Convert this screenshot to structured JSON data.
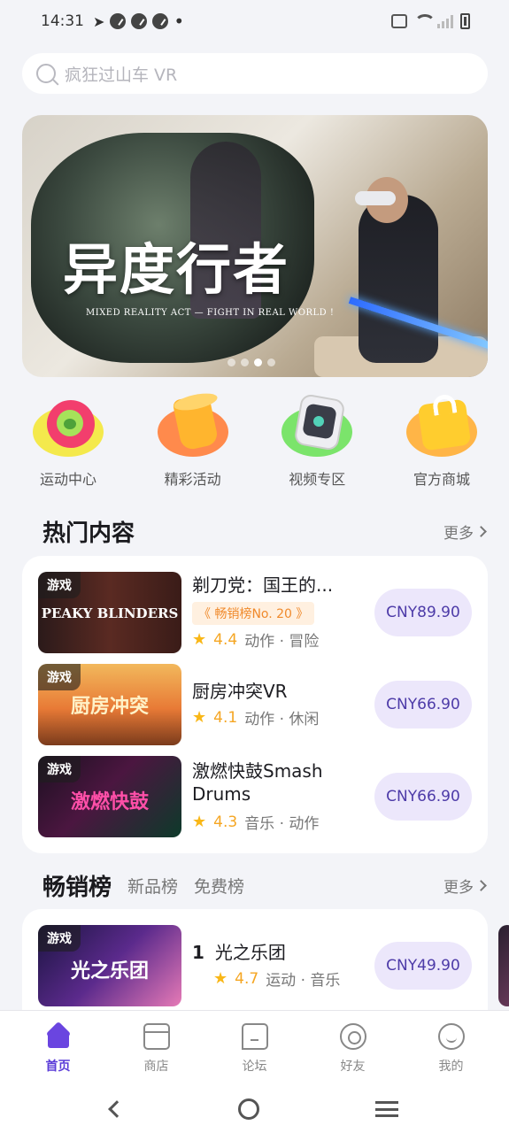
{
  "status_bar": {
    "time": "14:31"
  },
  "search": {
    "placeholder": "疯狂过山车 VR"
  },
  "banner": {
    "title": "异度行者",
    "subtitle": "MIXED REALITY ACT — FIGHT IN REAL WORLD !",
    "dots": 4,
    "active_dot": 3
  },
  "quick_entries": [
    {
      "label": "运动中心",
      "icon": "sport-center-icon"
    },
    {
      "label": "精彩活动",
      "icon": "events-icon"
    },
    {
      "label": "视频专区",
      "icon": "video-zone-icon"
    },
    {
      "label": "官方商城",
      "icon": "official-store-icon"
    }
  ],
  "hot": {
    "title": "热门内容",
    "more": "更多",
    "items": [
      {
        "tag": "游戏",
        "thumb_text": "PEAKY BLINDERS",
        "title": "剃刀党：国王的...",
        "badge": "《 畅销榜No. 20 》",
        "score": "4.4",
        "genres": "动作 · 冒险",
        "price": "CNY89.90"
      },
      {
        "tag": "游戏",
        "thumb_text": "厨房冲突",
        "title": "厨房冲突VR",
        "score": "4.1",
        "genres": "动作 · 休闲",
        "price": "CNY66.90"
      },
      {
        "tag": "游戏",
        "thumb_text": "激燃快鼓",
        "title_line1": "激燃快鼓Smash",
        "title_line2": "Drums",
        "score": "4.3",
        "genres": "音乐 · 动作",
        "price": "CNY66.90"
      }
    ]
  },
  "charts": {
    "tabs": [
      "畅销榜",
      "新品榜",
      "免费榜"
    ],
    "more": "更多",
    "items": [
      {
        "rank": "1",
        "tag": "游戏",
        "thumb_text": "光之乐团",
        "title": "光之乐团",
        "score": "4.7",
        "genres": "运动 · 音乐",
        "price": "CNY49.90"
      }
    ]
  },
  "bottom_nav": [
    {
      "label": "首页",
      "active": true
    },
    {
      "label": "商店"
    },
    {
      "label": "论坛"
    },
    {
      "label": "好友"
    },
    {
      "label": "我的"
    }
  ],
  "colors": {
    "accent": "#6a45e0",
    "price_bg": "#ece7fb",
    "star": "#f9b717",
    "badge": "#f08a2c"
  }
}
